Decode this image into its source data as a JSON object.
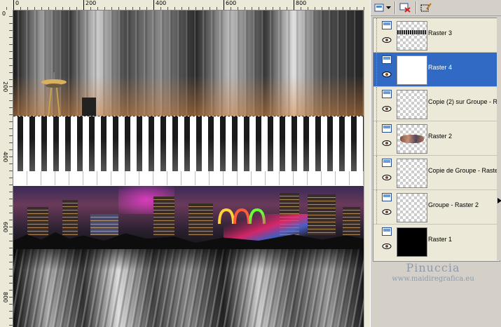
{
  "ruler": {
    "top_labels": [
      "0",
      "200",
      "400",
      "600",
      "800"
    ],
    "left_labels": [
      "0",
      "200",
      "400",
      "600",
      "800"
    ]
  },
  "layers": [
    {
      "name": "Raster 3",
      "selected": false,
      "thumb": "checker-strip"
    },
    {
      "name": "Raster 4",
      "selected": true,
      "thumb": "blank"
    },
    {
      "name": "Copie (2) sur Groupe - R",
      "selected": false,
      "thumb": "checker"
    },
    {
      "name": "Raster 2",
      "selected": false,
      "thumb": "checker-brush"
    },
    {
      "name": "Copie de Groupe - Raste",
      "selected": false,
      "thumb": "checker"
    },
    {
      "name": "Groupe - Raster 2",
      "selected": false,
      "thumb": "checker"
    },
    {
      "name": "Raster 1",
      "selected": false,
      "thumb": "black"
    }
  ],
  "watermark": {
    "name": "Pinuccia",
    "url": "www.maidiregrafica.eu"
  },
  "colors": {
    "selection": "#316ac5",
    "panel": "#d4d0c8",
    "watermark": "#8a9bb0"
  },
  "toolbar_icons": [
    "layer-props-icon",
    "dropdown-arrow-icon",
    "delete-layer-icon",
    "edit-selection-icon"
  ]
}
